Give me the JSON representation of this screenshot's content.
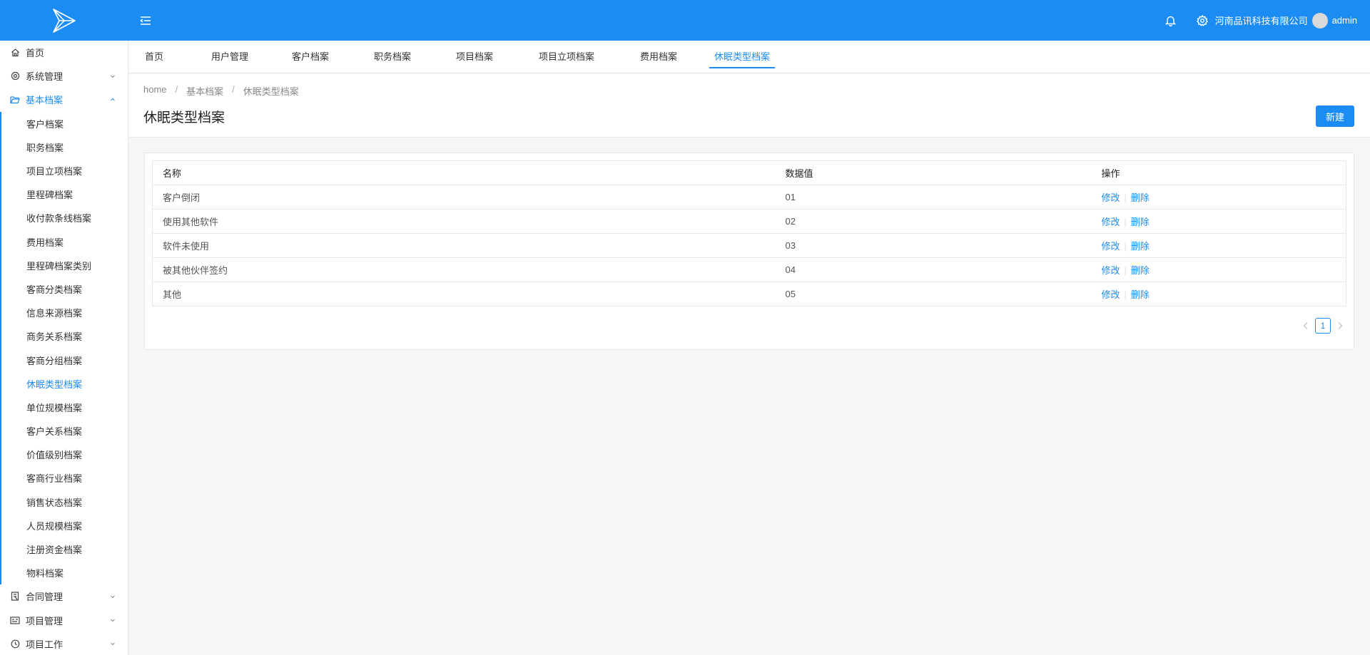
{
  "header": {
    "company": "河南品讯科技有限公司",
    "username": "admin",
    "accent_color": "#1c8cf5"
  },
  "sidebar": {
    "items": [
      {
        "label": "首页",
        "icon": "home-icon"
      },
      {
        "label": "系统管理",
        "icon": "gear-icon"
      },
      {
        "label": "基本档案",
        "icon": "folder-open-icon",
        "open": true,
        "children": [
          "客户档案",
          "职务档案",
          "项目立项档案",
          "里程碑档案",
          "收付款条线档案",
          "费用档案",
          "里程碑档案类别",
          "客商分类档案",
          "信息来源档案",
          "商务关系档案",
          "客商分组档案",
          "休眠类型档案",
          "单位规模档案",
          "客户关系档案",
          "价值级别档案",
          "客商行业档案",
          "销售状态档案",
          "人员规模档案",
          "注册资金档案",
          "物料档案"
        ],
        "active_child": "休眠类型档案"
      },
      {
        "label": "合同管理",
        "icon": "contract-icon"
      },
      {
        "label": "项目管理",
        "icon": "project-icon"
      },
      {
        "label": "项目工作",
        "icon": "clock-icon"
      }
    ]
  },
  "tabs": [
    "首页",
    "用户管理",
    "客户档案",
    "职务档案",
    "项目档案",
    "项目立项档案",
    "费用档案",
    "休眠类型档案"
  ],
  "active_tab": "休眠类型档案",
  "breadcrumb": [
    "home",
    "基本档案",
    "休眠类型档案"
  ],
  "page_title": "休眠类型档案",
  "new_button": "新建",
  "table": {
    "columns": [
      "名称",
      "数据值",
      "操作"
    ],
    "rows": [
      {
        "name": "客户倒闭",
        "value": "01"
      },
      {
        "name": "使用其他软件",
        "value": "02"
      },
      {
        "name": "软件未使用",
        "value": "03"
      },
      {
        "name": "被其他伙伴签约",
        "value": "04"
      },
      {
        "name": "其他",
        "value": "05"
      }
    ],
    "edit_label": "修改",
    "delete_label": "删除",
    "divider": "|"
  },
  "pagination": {
    "current_page": "1"
  }
}
